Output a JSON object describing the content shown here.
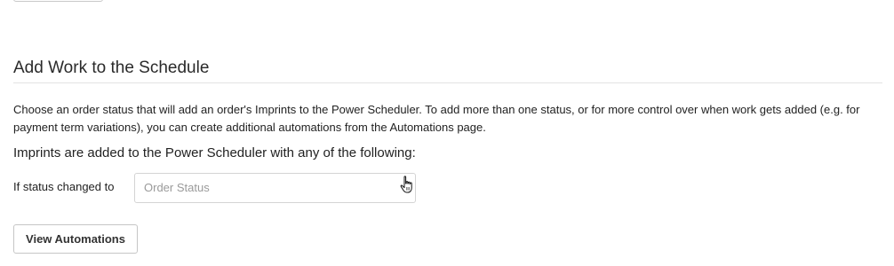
{
  "section": {
    "title": "Add Work to the Schedule",
    "description": "Choose an order status that will add an order's Imprints to the Power Scheduler. To add more than one status, or for more control over when work gets added (e.g. for payment term variations), you can create additional automations from the Automations page.",
    "subheading": "Imprints are added to the Power Scheduler with any of the following:"
  },
  "status_field": {
    "label": "If status changed to",
    "placeholder": "Order Status",
    "value": ""
  },
  "actions": {
    "view_automations_label": "View Automations"
  },
  "colors": {
    "border": "#d4d4d4",
    "placeholder": "#9a9a9a",
    "text": "#222222"
  },
  "icons": {
    "cursor": "hand-pointer-icon"
  }
}
